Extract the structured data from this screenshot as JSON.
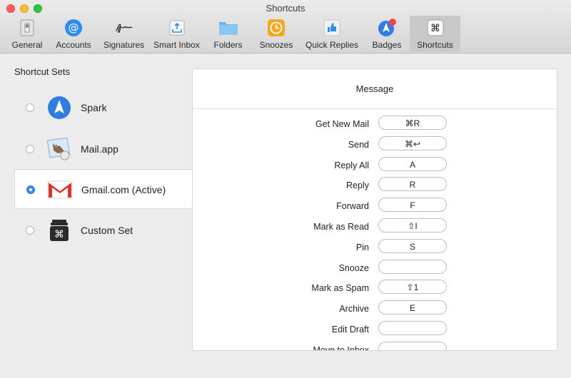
{
  "window": {
    "title": "Shortcuts"
  },
  "toolbar": {
    "items": [
      {
        "label": "General",
        "icon": "general-icon"
      },
      {
        "label": "Accounts",
        "icon": "accounts-icon"
      },
      {
        "label": "Signatures",
        "icon": "signatures-icon"
      },
      {
        "label": "Smart Inbox",
        "icon": "smart-inbox-icon"
      },
      {
        "label": "Folders",
        "icon": "folders-icon"
      },
      {
        "label": "Snoozes",
        "icon": "snoozes-icon"
      },
      {
        "label": "Quick Replies",
        "icon": "quick-replies-icon"
      },
      {
        "label": "Badges",
        "icon": "badges-icon"
      },
      {
        "label": "Shortcuts",
        "icon": "shortcuts-icon",
        "active": true
      }
    ]
  },
  "shortcut_sets": {
    "title": "Shortcut Sets",
    "items": [
      {
        "label": "Spark",
        "icon": "spark-icon",
        "selected": false
      },
      {
        "label": "Mail.app",
        "icon": "mail-app-icon",
        "selected": false
      },
      {
        "label": "Gmail.com (Active)",
        "icon": "gmail-icon",
        "selected": true
      },
      {
        "label": "Custom Set",
        "icon": "custom-set-icon",
        "selected": false
      }
    ]
  },
  "panel": {
    "header": "Message",
    "rows": [
      {
        "label": "Get New Mail",
        "key": "⌘R"
      },
      {
        "label": "Send",
        "key": "⌘↩"
      },
      {
        "label": "Reply All",
        "key": "A"
      },
      {
        "label": "Reply",
        "key": "R"
      },
      {
        "label": "Forward",
        "key": "F"
      },
      {
        "label": "Mark as Read",
        "key": "⇧I"
      },
      {
        "label": "Pin",
        "key": "S"
      },
      {
        "label": "Snooze",
        "key": ""
      },
      {
        "label": "Mark as Spam",
        "key": "⇧1"
      },
      {
        "label": "Archive",
        "key": "E"
      },
      {
        "label": "Edit Draft",
        "key": ""
      },
      {
        "label": "Move to Inbox",
        "key": ""
      }
    ]
  },
  "colors": {
    "accent": "#3b8bf0",
    "badge_red": "#f2473f",
    "traffic_close": "#fe5f57",
    "traffic_min": "#febc2e",
    "traffic_max": "#28c840"
  }
}
